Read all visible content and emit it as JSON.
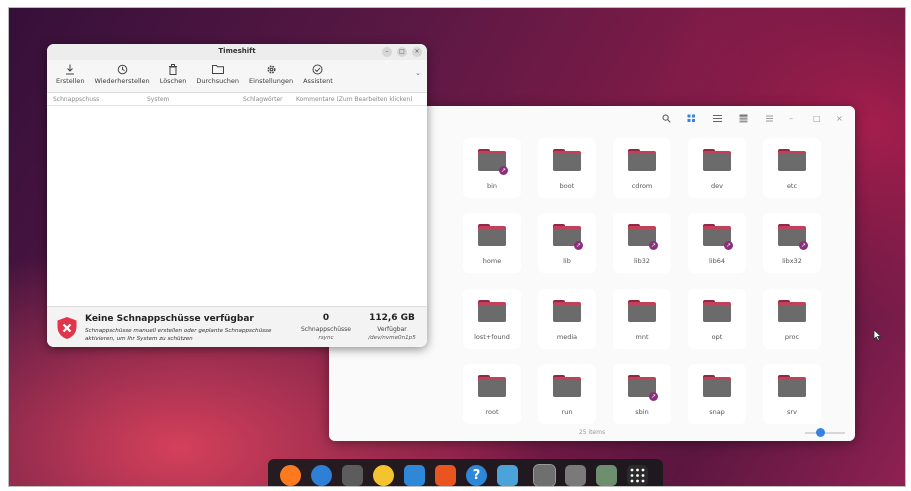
{
  "timeshift": {
    "title": "Timeshift",
    "toolbar": [
      {
        "label": "Erstellen",
        "icon": "download-icon"
      },
      {
        "label": "Wiederherstellen",
        "icon": "restore-icon"
      },
      {
        "label": "Löschen",
        "icon": "trash-icon"
      },
      {
        "label": "Durchsuchen",
        "icon": "folder-icon"
      },
      {
        "label": "Einstellungen",
        "icon": "gear-icon"
      },
      {
        "label": "Assistent",
        "icon": "check-circle-icon"
      }
    ],
    "columns": {
      "snapshot": "Schnappschuss",
      "system": "System",
      "tags": "Schlagwörter",
      "comments": "Kommentare (Zum Bearbeiten klicken)"
    },
    "status": {
      "heading": "Keine Schnappschüsse verfügbar",
      "hint": "Schnappschüsse manuell erstellen oder geplante Schnappschüsse aktivieren, um Ihr System zu schützen",
      "count": "0",
      "count_label": "Schnappschüsse",
      "count_sub": "rsync",
      "free": "112,6 GB",
      "free_label": "Verfügbar",
      "free_sub": "/dev/nvme0n1p5"
    }
  },
  "files": {
    "folders": [
      {
        "name": "bin",
        "link": true
      },
      {
        "name": "boot",
        "link": false
      },
      {
        "name": "cdrom",
        "link": false
      },
      {
        "name": "dev",
        "link": false
      },
      {
        "name": "etc",
        "link": false
      },
      {
        "name": "home",
        "link": false
      },
      {
        "name": "lib",
        "link": true
      },
      {
        "name": "lib32",
        "link": true
      },
      {
        "name": "lib64",
        "link": true
      },
      {
        "name": "libx32",
        "link": true
      },
      {
        "name": "lost+found",
        "link": false
      },
      {
        "name": "media",
        "link": false
      },
      {
        "name": "mnt",
        "link": false
      },
      {
        "name": "opt",
        "link": false
      },
      {
        "name": "proc",
        "link": false
      },
      {
        "name": "root",
        "link": false
      },
      {
        "name": "run",
        "link": false
      },
      {
        "name": "sbin",
        "link": true
      },
      {
        "name": "snap",
        "link": false
      },
      {
        "name": "srv",
        "link": false
      }
    ],
    "item_count": "25 items",
    "header_icons": [
      "search-icon",
      "grid-view-icon",
      "list-view-icon",
      "menu-icon",
      "minimize-icon",
      "maximize-icon",
      "close-icon"
    ]
  },
  "dock": {
    "apps": [
      {
        "name": "firefox-icon",
        "color": "#ff7a1f"
      },
      {
        "name": "thunderbird-icon",
        "color": "#2f7fd6"
      },
      {
        "name": "files-icon",
        "color": "#5c5c5c"
      },
      {
        "name": "rhythmbox-icon",
        "color": "#f4c430"
      },
      {
        "name": "writer-icon",
        "color": "#2f87d8"
      },
      {
        "name": "app-center-icon",
        "color": "#e95420"
      },
      {
        "name": "help-icon",
        "color": "#2f87d8"
      },
      {
        "name": "trash-icon",
        "color": "#4aa3d9"
      },
      {
        "name": "timeshift-icon",
        "color": "#6f6f6f"
      },
      {
        "name": "disks-icon",
        "color": "#7a7a7a"
      },
      {
        "name": "recycle-icon",
        "color": "#6d8f6d"
      },
      {
        "name": "show-apps-icon",
        "color": "#2a2a2a"
      }
    ]
  }
}
